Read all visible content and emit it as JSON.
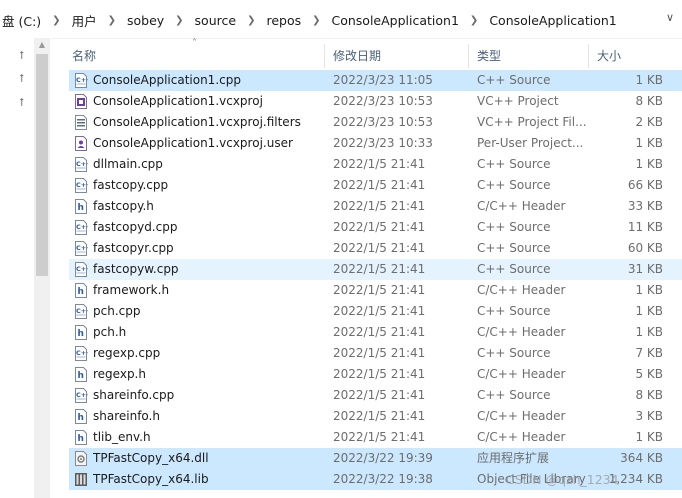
{
  "breadcrumb": [
    "盘 (C:)",
    "用户",
    "sobey",
    "source",
    "repos",
    "ConsoleApplication1",
    "ConsoleApplication1"
  ],
  "columns": {
    "name": "名称",
    "date": "修改日期",
    "type": "类型",
    "size": "大小"
  },
  "files": [
    {
      "name": "ConsoleApplication1.cpp",
      "date": "2022/3/23 11:05",
      "type": "C++ Source",
      "size": "1 KB",
      "icon": "cpp-icon",
      "state": "selected"
    },
    {
      "name": "ConsoleApplication1.vcxproj",
      "date": "2022/3/23 10:53",
      "type": "VC++ Project",
      "size": "8 KB",
      "icon": "vcxproj-icon",
      "state": ""
    },
    {
      "name": "ConsoleApplication1.vcxproj.filters",
      "date": "2022/3/23 10:53",
      "type": "VC++ Project Fil...",
      "size": "2 KB",
      "icon": "filters-icon",
      "state": ""
    },
    {
      "name": "ConsoleApplication1.vcxproj.user",
      "date": "2022/3/23 10:33",
      "type": "Per-User Project...",
      "size": "1 KB",
      "icon": "user-proj-icon",
      "state": ""
    },
    {
      "name": "dllmain.cpp",
      "date": "2022/1/5 21:41",
      "type": "C++ Source",
      "size": "1 KB",
      "icon": "cpp-icon",
      "state": ""
    },
    {
      "name": "fastcopy.cpp",
      "date": "2022/1/5 21:41",
      "type": "C++ Source",
      "size": "66 KB",
      "icon": "cpp-icon",
      "state": ""
    },
    {
      "name": "fastcopy.h",
      "date": "2022/1/5 21:41",
      "type": "C/C++ Header",
      "size": "33 KB",
      "icon": "header-icon",
      "state": ""
    },
    {
      "name": "fastcopyd.cpp",
      "date": "2022/1/5 21:41",
      "type": "C++ Source",
      "size": "11 KB",
      "icon": "cpp-icon",
      "state": ""
    },
    {
      "name": "fastcopyr.cpp",
      "date": "2022/1/5 21:41",
      "type": "C++ Source",
      "size": "60 KB",
      "icon": "cpp-icon",
      "state": ""
    },
    {
      "name": "fastcopyw.cpp",
      "date": "2022/1/5 21:41",
      "type": "C++ Source",
      "size": "31 KB",
      "icon": "cpp-icon",
      "state": "hover"
    },
    {
      "name": "framework.h",
      "date": "2022/1/5 21:41",
      "type": "C/C++ Header",
      "size": "1 KB",
      "icon": "header-icon",
      "state": ""
    },
    {
      "name": "pch.cpp",
      "date": "2022/1/5 21:41",
      "type": "C++ Source",
      "size": "1 KB",
      "icon": "cpp-icon",
      "state": ""
    },
    {
      "name": "pch.h",
      "date": "2022/1/5 21:41",
      "type": "C/C++ Header",
      "size": "1 KB",
      "icon": "header-icon",
      "state": ""
    },
    {
      "name": "regexp.cpp",
      "date": "2022/1/5 21:41",
      "type": "C++ Source",
      "size": "7 KB",
      "icon": "cpp-icon",
      "state": ""
    },
    {
      "name": "regexp.h",
      "date": "2022/1/5 21:41",
      "type": "C/C++ Header",
      "size": "5 KB",
      "icon": "header-icon",
      "state": ""
    },
    {
      "name": "shareinfo.cpp",
      "date": "2022/1/5 21:41",
      "type": "C++ Source",
      "size": "8 KB",
      "icon": "cpp-icon",
      "state": ""
    },
    {
      "name": "shareinfo.h",
      "date": "2022/1/5 21:41",
      "type": "C/C++ Header",
      "size": "3 KB",
      "icon": "header-icon",
      "state": ""
    },
    {
      "name": "tlib_env.h",
      "date": "2022/1/5 21:41",
      "type": "C/C++ Header",
      "size": "1 KB",
      "icon": "header-icon",
      "state": ""
    },
    {
      "name": "TPFastCopy_x64.dll",
      "date": "2022/3/22 19:39",
      "type": "应用程序扩展",
      "size": "364 KB",
      "icon": "dll-icon",
      "state": "selected"
    },
    {
      "name": "TPFastCopy_x64.lib",
      "date": "2022/3/22 19:38",
      "type": "Object File Library",
      "size": "1,234 KB",
      "icon": "lib-icon",
      "state": "selected"
    }
  ],
  "watermark": "CSDN @qzh_1234",
  "colors": {
    "selected": "#cce8ff",
    "hover": "#e5f3ff",
    "header_text": "#4c607a"
  }
}
